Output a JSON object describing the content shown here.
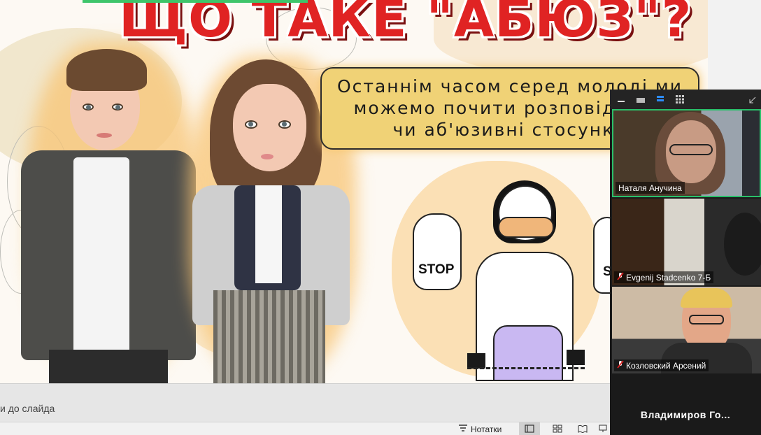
{
  "slide": {
    "title": "ЩО ТАКЕ \"АБЮЗ\"?",
    "speech_lines": [
      "Останнім часом серед молоді ми",
      "можемо почити розповіді про",
      "чи аб'юзивні стосунки"
    ],
    "stop_left": "STOP",
    "stop_right": "S"
  },
  "editor": {
    "notes_hint": "и до слайда",
    "notes_button": "Нотатки",
    "view_icons": [
      "normal-view-icon",
      "slide-sorter-icon",
      "reading-view-icon",
      "slideshow-icon"
    ]
  },
  "zoom": {
    "toolbar_icons": [
      "minimize-icon",
      "speaker-view-icon",
      "strip-view-icon",
      "gallery-view-icon",
      "exit-fullscreen-icon"
    ],
    "participants": [
      {
        "name": "Наталя Анучина",
        "muted": false,
        "active": true
      },
      {
        "name": "Evgenij Stadcenko 7-Б",
        "muted": true,
        "active": false
      },
      {
        "name": "Козловский Арсений",
        "muted": true,
        "active": false
      }
    ],
    "bottom_participant": "Владимиров Го..."
  },
  "colors": {
    "title_red": "#e02323",
    "speech_yellow": "#f0d276",
    "active_speaker_green": "#29c06a",
    "skirt_lavender": "#c9b8f2"
  }
}
